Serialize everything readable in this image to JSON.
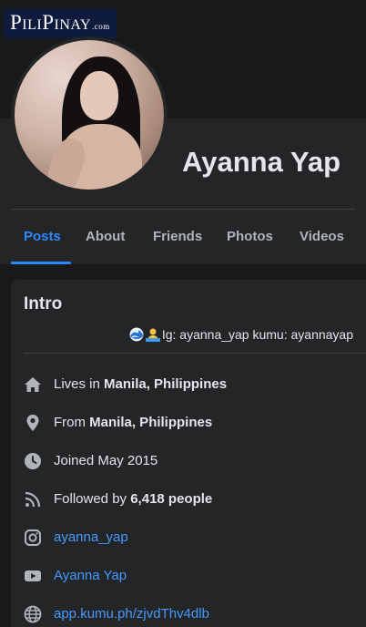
{
  "watermark": {
    "brand": "PiliPinay",
    "domain": ".com"
  },
  "profile": {
    "name": "Ayanna Yap"
  },
  "tabs": [
    {
      "label": "Posts",
      "active": true
    },
    {
      "label": "About",
      "active": false
    },
    {
      "label": "Friends",
      "active": false
    },
    {
      "label": "Photos",
      "active": false
    },
    {
      "label": "Videos",
      "active": false
    }
  ],
  "intro": {
    "title": "Intro",
    "bio_emojis": [
      "wave-emoji",
      "person-emoji"
    ],
    "bio": "Ig: ayanna_yap kumu: ayannayap",
    "lives_prefix": "Lives in ",
    "lives_place": "Manila, Philippines",
    "from_prefix": "From ",
    "from_place": "Manila, Philippines",
    "joined": "Joined May 2015",
    "followed_prefix": "Followed by ",
    "followed_count": "6,418 people",
    "instagram": "ayanna_yap",
    "youtube": "Ayanna Yap",
    "website": "app.kumu.ph/zjvdThv4dlb",
    "icons": [
      "home-icon",
      "location-pin-icon",
      "clock-icon",
      "rss-icon",
      "instagram-icon",
      "youtube-icon",
      "globe-icon"
    ]
  },
  "colors": {
    "page_bg": "#18191a",
    "card_bg": "#242526",
    "accent": "#2d88ff",
    "link": "#4599ff",
    "text": "#e4e6eb",
    "muted": "#b0b3b8"
  }
}
